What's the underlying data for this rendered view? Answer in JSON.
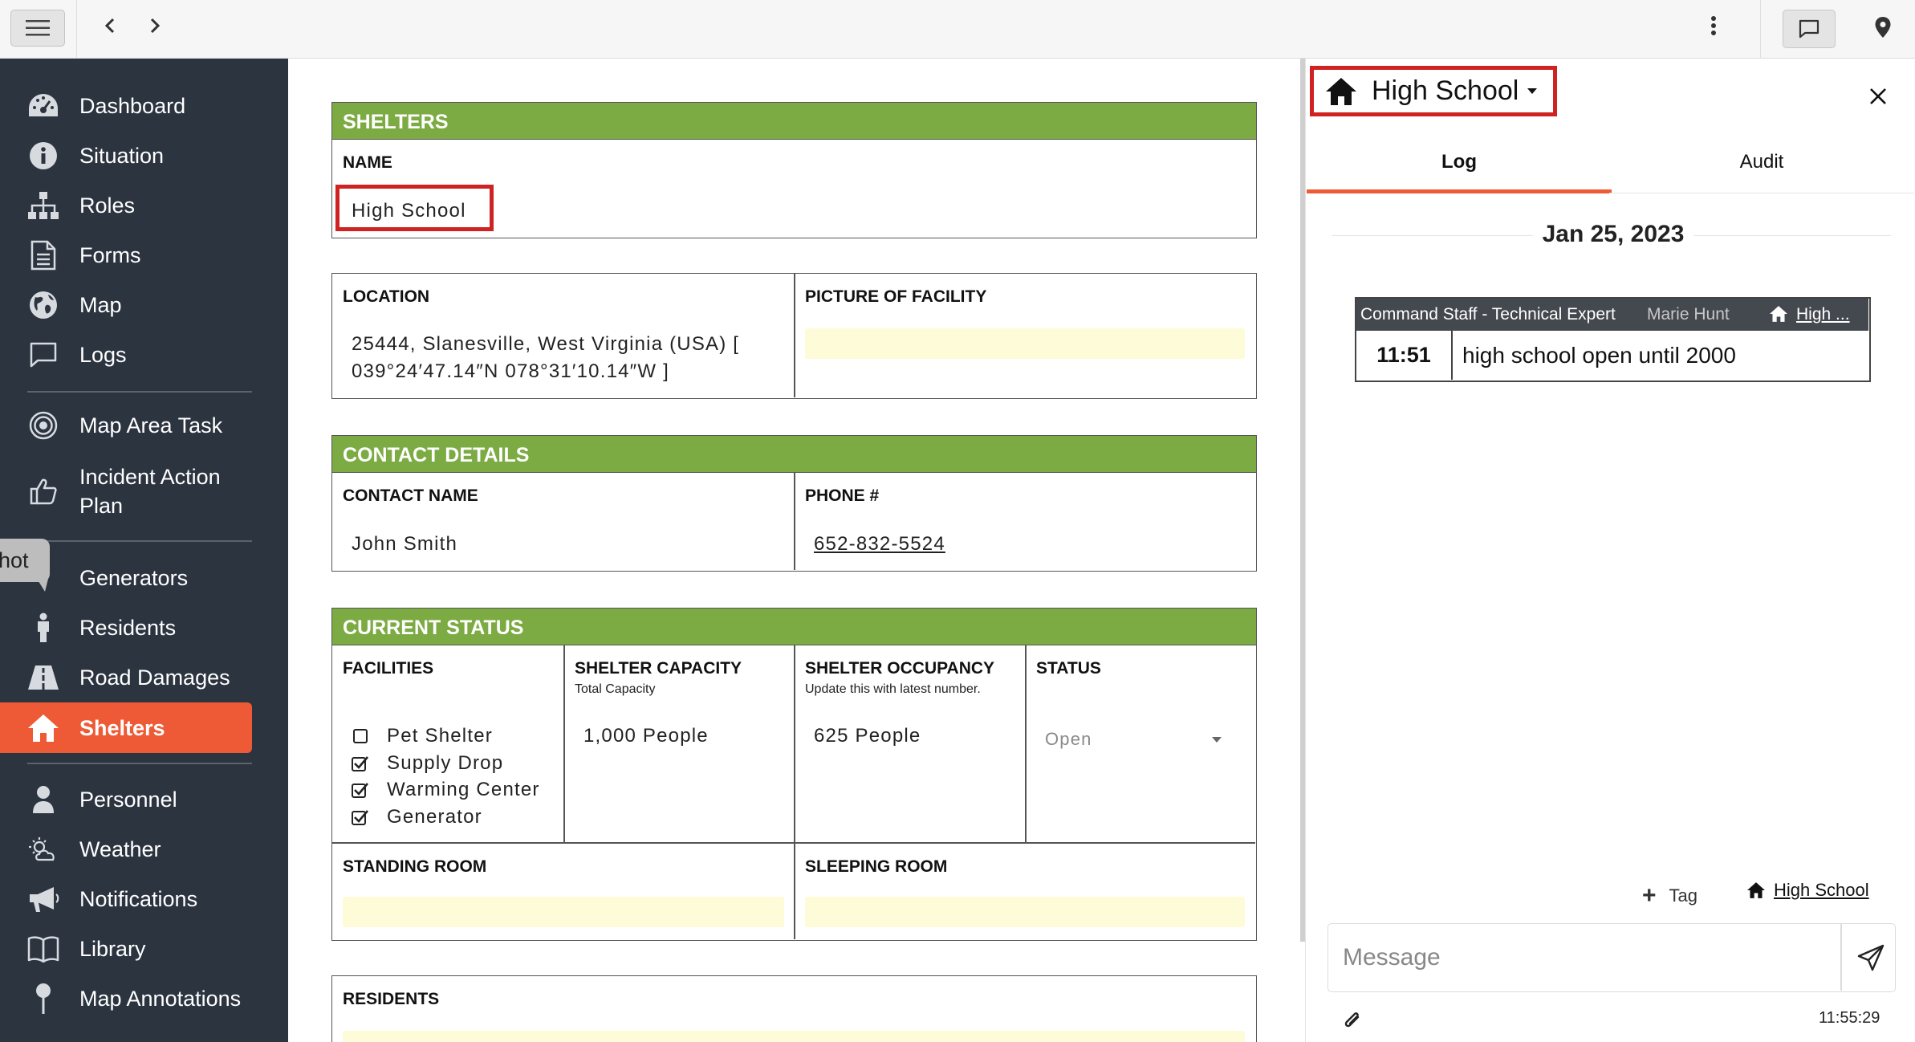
{
  "sidebar": {
    "items": [
      {
        "label": "Dashboard",
        "icon": "dashboard-icon"
      },
      {
        "label": "Situation",
        "icon": "info-icon"
      },
      {
        "label": "Roles",
        "icon": "org-chart-icon"
      },
      {
        "label": "Forms",
        "icon": "document-icon"
      },
      {
        "label": "Map",
        "icon": "globe-icon"
      },
      {
        "label": "Logs",
        "icon": "chat-icon"
      },
      {
        "label": "Map Area Task",
        "icon": "target-icon"
      },
      {
        "label": "Incident Action Plan",
        "icon": "thumbs-up-icon"
      },
      {
        "label": "Generators",
        "icon": "generator-icon"
      },
      {
        "label": "Residents",
        "icon": "person-icon"
      },
      {
        "label": "Road Damages",
        "icon": "road-icon"
      },
      {
        "label": "Shelters",
        "icon": "home-icon"
      },
      {
        "label": "Personnel",
        "icon": "user-icon"
      },
      {
        "label": "Weather",
        "icon": "weather-icon"
      },
      {
        "label": "Notifications",
        "icon": "megaphone-icon"
      },
      {
        "label": "Library",
        "icon": "book-icon"
      },
      {
        "label": "Map Annotations",
        "icon": "pin-icon"
      }
    ],
    "active": "Shelters",
    "tooltip": "hot"
  },
  "form": {
    "shelters": {
      "header": "SHELTERS",
      "name_label": "NAME",
      "name_value": "High School"
    },
    "location": {
      "label": "LOCATION",
      "line1": "25444, Slanesville, West Virginia (USA) [",
      "line2": "039°24′47.14″N 078°31′10.14″W ]",
      "picture_label": "PICTURE OF FACILITY"
    },
    "contact": {
      "header": "CONTACT DETAILS",
      "name_label": "CONTACT NAME",
      "name_value": "John Smith",
      "phone_label": "PHONE #",
      "phone_value": "652-832-5524"
    },
    "status": {
      "header": "CURRENT STATUS",
      "facilities_label": "FACILITIES",
      "facilities": [
        {
          "label": "Pet Shelter",
          "checked": false
        },
        {
          "label": "Supply Drop",
          "checked": true
        },
        {
          "label": "Warming Center",
          "checked": true
        },
        {
          "label": "Generator",
          "checked": true
        }
      ],
      "capacity_label": "SHELTER CAPACITY",
      "capacity_sub": "Total Capacity",
      "capacity_value": "1,000 People",
      "occupancy_label": "SHELTER OCCUPANCY",
      "occupancy_sub": "Update this with latest number.",
      "occupancy_value": "625 People",
      "status_label": "STATUS",
      "status_value": "Open",
      "standing_label": "STANDING ROOM",
      "sleeping_label": "SLEEPING ROOM"
    },
    "residents": {
      "label": "RESIDENTS"
    }
  },
  "panel": {
    "title": "High School",
    "tabs": [
      "Log",
      "Audit"
    ],
    "active_tab": "Log",
    "date": "Jan 25, 2023",
    "log_entry": {
      "role": "Command Staff - Technical Expert",
      "user": "Marie Hunt",
      "tag": "High ...",
      "time": "11:51",
      "message": "high school open until 2000"
    },
    "tag_button": "Tag",
    "shelter_tag": "High School",
    "message_placeholder": "Message",
    "clock": "11:55:29"
  },
  "colors": {
    "sidebar_bg": "#2c3440",
    "accent": "#ef5a36",
    "section_header": "#7cab43",
    "highlight": "#cf2323",
    "field_yellow": "#fefbd8"
  }
}
